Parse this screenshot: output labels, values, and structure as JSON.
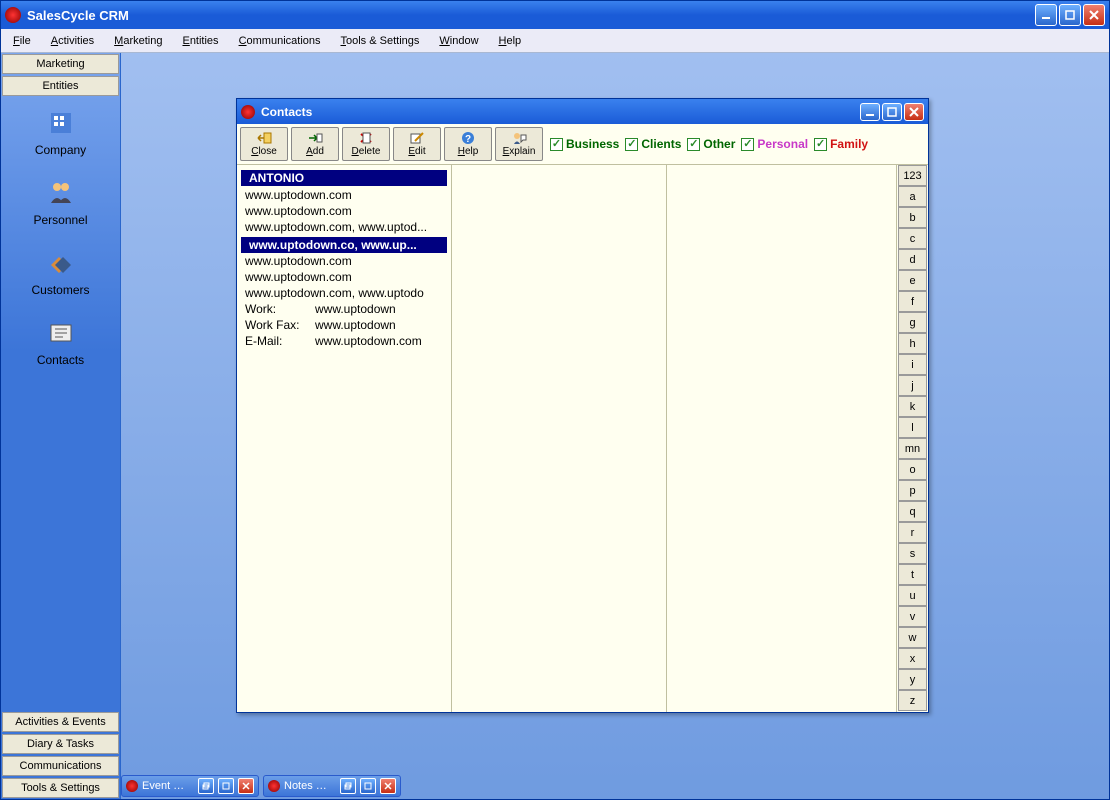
{
  "app": {
    "title": "SalesCycle CRM"
  },
  "menu": [
    "File",
    "Activities",
    "Marketing",
    "Entities",
    "Communications",
    "Tools & Settings",
    "Window",
    "Help"
  ],
  "menu_u": [
    "F",
    "A",
    "M",
    "E",
    "C",
    "T",
    "W",
    "H"
  ],
  "sidebar_headers_top": [
    "Marketing",
    "Entities"
  ],
  "sidebar_items": [
    {
      "label": "Company"
    },
    {
      "label": "Personnel"
    },
    {
      "label": "Customers"
    },
    {
      "label": "Contacts"
    }
  ],
  "sidebar_headers_bottom": [
    "Activities & Events",
    "Diary & Tasks",
    "Communications",
    "Tools & Settings"
  ],
  "contacts": {
    "title": "Contacts",
    "toolbar": [
      {
        "name": "close",
        "label": "Close"
      },
      {
        "name": "add",
        "label": "Add"
      },
      {
        "name": "delete",
        "label": "Delete"
      },
      {
        "name": "edit",
        "label": "Edit"
      },
      {
        "name": "help",
        "label": "Help"
      },
      {
        "name": "explain",
        "label": "Explain"
      }
    ],
    "filters": [
      {
        "label": "Business",
        "color": "#006600"
      },
      {
        "label": "Clients",
        "color": "#006600"
      },
      {
        "label": "Other",
        "color": "#006600"
      },
      {
        "label": "Personal",
        "color": "#c838c8"
      },
      {
        "label": "Family",
        "color": "#d11313"
      }
    ],
    "list": [
      {
        "text": "ANTONIO",
        "style": "header"
      },
      {
        "text": "www.uptodown.com"
      },
      {
        "text": "www.uptodown.com"
      },
      {
        "text": "www.uptodown.com, www.uptod..."
      },
      {
        "text": ""
      },
      {
        "text": "www.uptodown.co, www.up...",
        "style": "sel"
      },
      {
        "text": "www.uptodown.com"
      },
      {
        "text": "www.uptodown.com"
      },
      {
        "text": "www.uptodown.com,  www.uptodo"
      }
    ],
    "details": [
      {
        "label": "Work:",
        "value": "www.uptodown"
      },
      {
        "label": "Work Fax:",
        "value": "www.uptodown"
      },
      {
        "label": "E-Mail:",
        "value": "www.uptodown.com"
      }
    ],
    "alpha": [
      "123",
      "a",
      "b",
      "c",
      "d",
      "e",
      "f",
      "g",
      "h",
      "i",
      "j",
      "k",
      "l",
      "mn",
      "o",
      "p",
      "q",
      "r",
      "s",
      "t",
      "u",
      "v",
      "w",
      "x",
      "y",
      "z"
    ]
  },
  "taskbar": [
    {
      "label": "Event …"
    },
    {
      "label": "Notes …"
    }
  ]
}
